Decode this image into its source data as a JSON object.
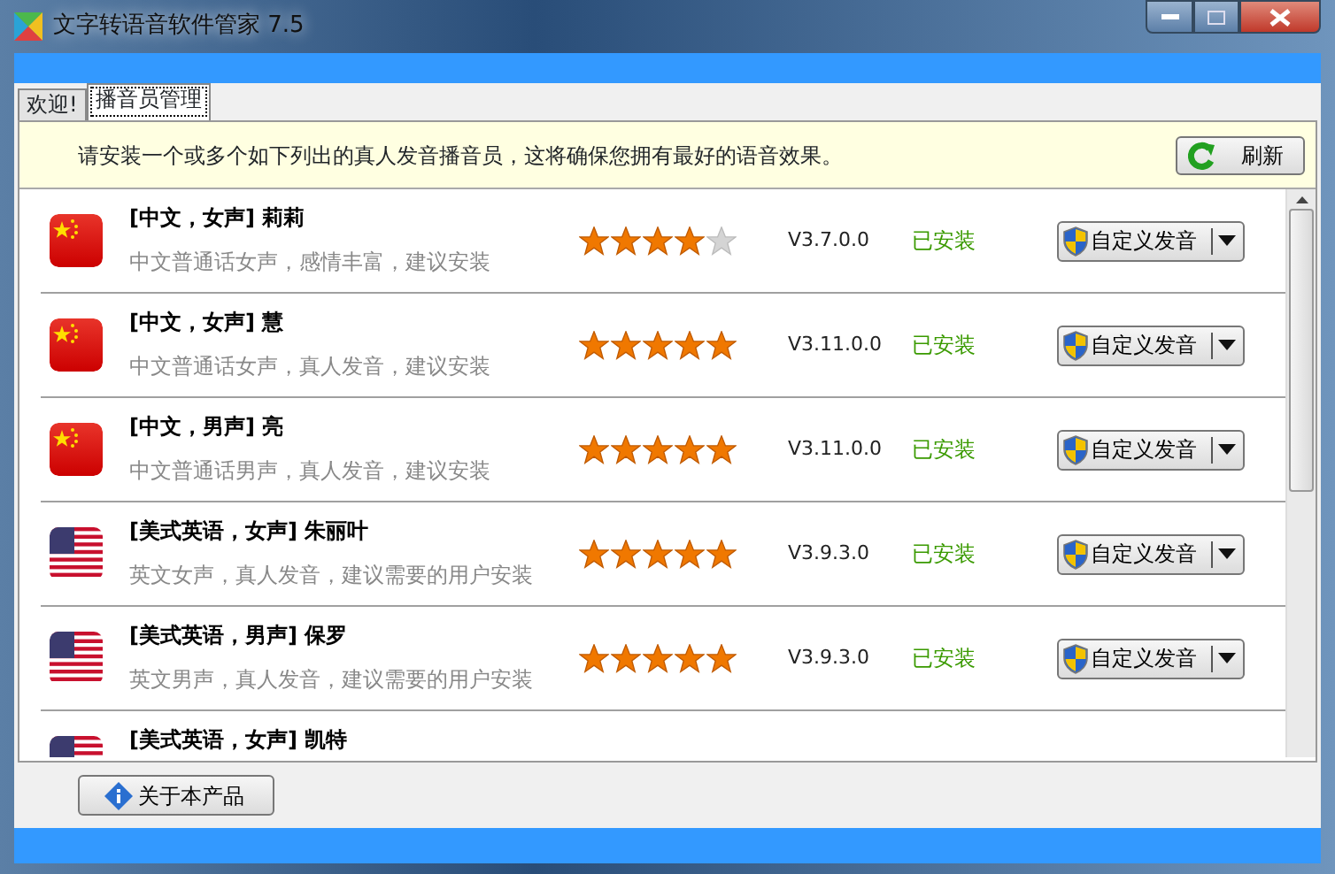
{
  "window": {
    "title": "文字转语音软件管家 7.5"
  },
  "tabs": [
    {
      "label": "欢迎!",
      "selected": false
    },
    {
      "label": "播音员管理",
      "selected": true
    }
  ],
  "notice": "请安装一个或多个如下列出的真人发音播音员，这将确保您拥有最好的语音效果。",
  "refresh_button": "刷新",
  "voices": [
    {
      "kind": "cn",
      "title": "[中文，女声] 莉莉",
      "description": "中文普通话女声，感情丰富，建议安装",
      "stars": 4,
      "version": "V3.7.0.0",
      "status": "已安装",
      "button": "自定义发音"
    },
    {
      "kind": "cn",
      "title": "[中文，女声] 慧",
      "description": "中文普通话女声，真人发音，建议安装",
      "stars": 5,
      "version": "V3.11.0.0",
      "status": "已安装",
      "button": "自定义发音"
    },
    {
      "kind": "cn",
      "title": "[中文，男声] 亮",
      "description": "中文普通话男声，真人发音，建议安装",
      "stars": 5,
      "version": "V3.11.0.0",
      "status": "已安装",
      "button": "自定义发音"
    },
    {
      "kind": "us",
      "title": "[美式英语，女声] 朱丽叶",
      "description": "英文女声，真人发音，建议需要的用户安装",
      "stars": 5,
      "version": "V3.9.3.0",
      "status": "已安装",
      "button": "自定义发音"
    },
    {
      "kind": "us",
      "title": "[美式英语，男声] 保罗",
      "description": "英文男声，真人发音，建议需要的用户安装",
      "stars": 5,
      "version": "V3.9.3.0",
      "status": "已安装",
      "button": "自定义发音"
    },
    {
      "kind": "us",
      "title": "[美式英语，女声] 凯特"
    }
  ],
  "about_button": "关于本产品"
}
